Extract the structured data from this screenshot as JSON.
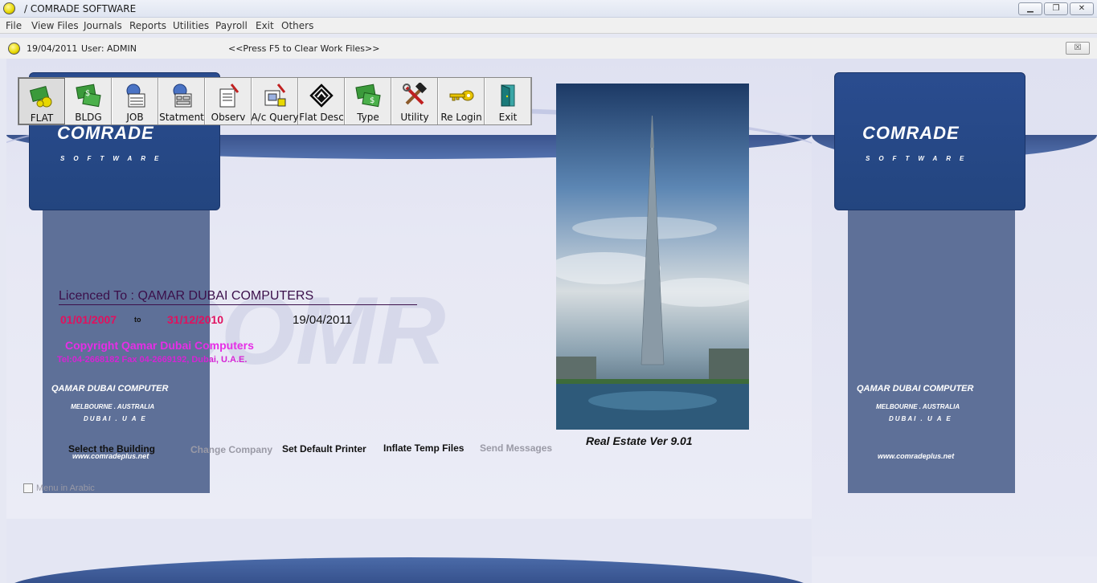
{
  "window": {
    "title": "/ COMRADE SOFTWARE",
    "minimize_glyph": "▁",
    "restore_glyph": "❐",
    "close_glyph": "✕"
  },
  "menu": [
    "File",
    "View Files",
    "Journals",
    "Reports",
    "Utilities",
    "Payroll",
    "Exit",
    "Others"
  ],
  "status": {
    "date": "19/04/2011",
    "user_label": "User:",
    "user": "ADMIN",
    "hint": "<<Press F5 to Clear Work Files>>",
    "close_glyph": "☒"
  },
  "toolbar": [
    {
      "label": "FLAT",
      "icon": "flat-money-icon"
    },
    {
      "label": "BLDG",
      "icon": "building-money-icon"
    },
    {
      "label": "JOB",
      "icon": "job-sheet-icon"
    },
    {
      "label": "Statment",
      "icon": "statement-sheet-icon"
    },
    {
      "label": "Observ",
      "icon": "observation-clipboard-icon"
    },
    {
      "label": "A/c Query",
      "icon": "account-query-icon"
    },
    {
      "label": "Flat Desc",
      "icon": "diamond-sign-icon"
    },
    {
      "label": "Type",
      "icon": "type-money-icon"
    },
    {
      "label": "Utility",
      "icon": "hammer-wrench-icon"
    },
    {
      "label": "Re Login",
      "icon": "key-icon"
    },
    {
      "label": "Exit",
      "icon": "exit-door-icon"
    }
  ],
  "branding": {
    "logo": "COMRADE",
    "logo_sub": "SOFTWARE",
    "company": "QAMAR DUBAI COMPUTER",
    "line1": "MELBOURNE . AUSTRALIA",
    "line2": "DUBAI . U A E",
    "website": "www.comradeplus.net"
  },
  "license": {
    "licensed_to": "Licenced To : QAMAR DUBAI COMPUTERS",
    "from_date": "01/01/2007",
    "to_word": "to",
    "to_date": "31/12/2010",
    "current_date": "19/04/2011",
    "copyright": "Copyright  Qamar Dubai Computers",
    "contact": "Tel:04-2668182 Fax 04-2669192, Dubai, U.A.E."
  },
  "product": {
    "version": "Real Estate Ver 9.01"
  },
  "actions": {
    "select_building": "Select the Building",
    "change_company": "Change Company",
    "default_printer": "Set Default Printer",
    "inflate_temp": "Inflate Temp Files",
    "send_messages": "Send Messages"
  },
  "options": {
    "menu_arabic": "Menu in Arabic",
    "menu_arabic_checked": false
  },
  "colors": {
    "brand_blue": "#2a4c8f",
    "license_red": "#e0115f",
    "copyright_magenta": "#e62ee6"
  }
}
